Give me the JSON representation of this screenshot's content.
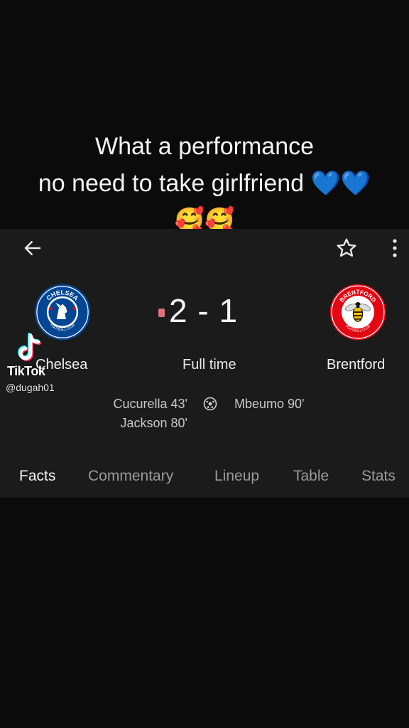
{
  "overlay": {
    "caption_line1": "What a performance",
    "caption_line2": "no need to take girlfriend 💙💙",
    "caption_line3": "🥰🥰",
    "watermark_brand": "TikTok",
    "watermark_handle": "@dugah01"
  },
  "match": {
    "home_team": "Chelsea",
    "away_team": "Brentford",
    "home_crest_text": "CHELSEA",
    "home_crest_subtext": "FOOTBALL CLUB",
    "away_crest_text": "BRENTFORD",
    "away_crest_subtext": "FOOTBALL CLUB",
    "score": "2 - 1",
    "status": "Full time",
    "home_scorers": [
      "Cucurella 43'",
      "Jackson 80'"
    ],
    "away_scorers": [
      "Mbeumo 90'"
    ]
  },
  "toolbar": {
    "back_icon": "arrow-left-icon",
    "star_icon": "star-outline-icon",
    "more_icon": "more-vert-icon"
  },
  "tabs": [
    "Facts",
    "Commentary",
    "Lineup",
    "Table",
    "Stats"
  ],
  "colors": {
    "background": "#0b0b0b",
    "card": "#1b1b1b",
    "live_indicator": "#e0707c",
    "chelsea_blue": "#034694",
    "brentford_red": "#e30613"
  }
}
